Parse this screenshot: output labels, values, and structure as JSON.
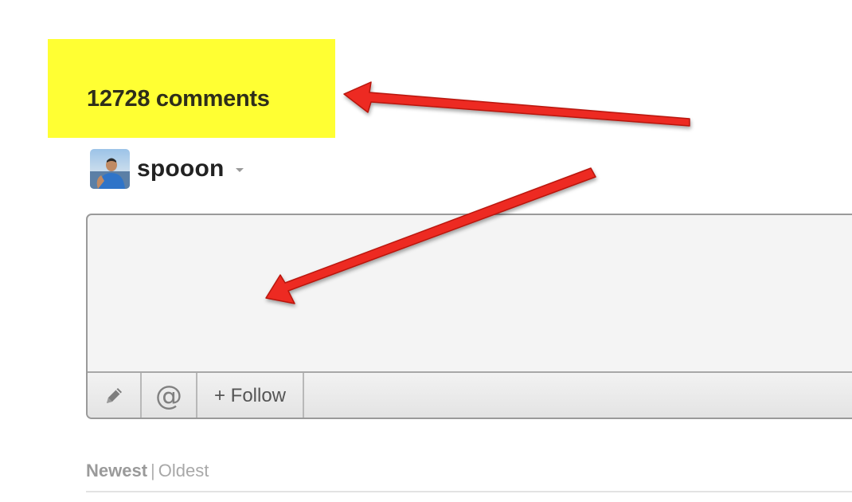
{
  "header": {
    "comment_count": "12728 comments",
    "highlight_color": "#ffff33"
  },
  "user": {
    "name": "spooon",
    "avatar": "user-avatar-photo",
    "menu_icon": "chevron-down-icon"
  },
  "composer": {
    "text_value": "",
    "placeholder": "",
    "tools": {
      "edit_icon": "pencil-icon",
      "mention_icon": "at-sign-icon",
      "mention_glyph": "@",
      "follow_label": "+ Follow"
    }
  },
  "sort": {
    "newest": "Newest",
    "separator": "|",
    "oldest": "Oldest",
    "active": "Newest"
  },
  "annotations": {
    "arrow_color": "#e8281e",
    "arrows": [
      "arrow-to-comment-count",
      "arrow-to-comment-box"
    ]
  }
}
